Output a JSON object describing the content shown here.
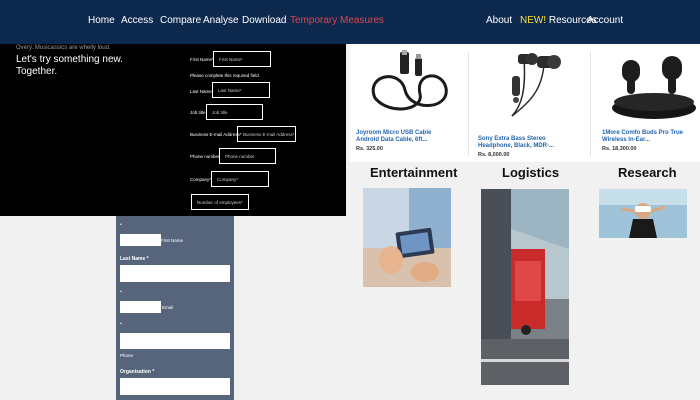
{
  "nav": {
    "left": [
      "Home",
      "Access",
      "Compare",
      "Analyse",
      "Download",
      "Temporary Measures"
    ],
    "right_about": "About",
    "right_new_badge": "NEW!",
    "right_resources": "Resources",
    "right_account": "Account"
  },
  "form": {
    "subline": "Overy. Musicassics are whelly loud.",
    "heading": "Let's try something new. Together.",
    "first_name_label": "First Name*",
    "first_name_placeholder": "First Name*",
    "error_text": "Please complete this required field.",
    "last_name_label": "Last Name*",
    "last_name_placeholder": "Last Name*",
    "job_title_label": "Job title",
    "job_title_placeholder": "Job title",
    "email_label": "Business E-mail Address*",
    "email_placeholder": "Business E-mail Address*",
    "phone_label": "Phone number",
    "phone_placeholder": "Phone number",
    "company_label": "Company*",
    "company_placeholder": "Company*",
    "employees_placeholder": "Number of employees*"
  },
  "side_form": {
    "bullet": "•",
    "first_name_text": "First Name",
    "last_name_label": "Last Name *",
    "email_text": "Email",
    "phone_text": "Phone",
    "organisation_label": "Organisation *"
  },
  "products": [
    {
      "title": "Joyroom Micro USB Cable Android Data Cable, 6ft...",
      "price": "Rs. 325.00"
    },
    {
      "title": "Sony Extra Bass Stereo Headphone, Black, MDR-...",
      "price": "Rs. 8,000.00"
    },
    {
      "title": "1More Comfo Buds Pro True Wireless In-Ear...",
      "price": "Rs. 18,300.00"
    }
  ],
  "categories": [
    "Entertainment",
    "Logistics",
    "Research"
  ],
  "colors": {
    "nav_bg": "#0d2a4e",
    "nav_active": "#e1434b",
    "new_badge": "#f5e03c",
    "product_link": "#2266b3",
    "side_form_bg": "#56657c"
  }
}
